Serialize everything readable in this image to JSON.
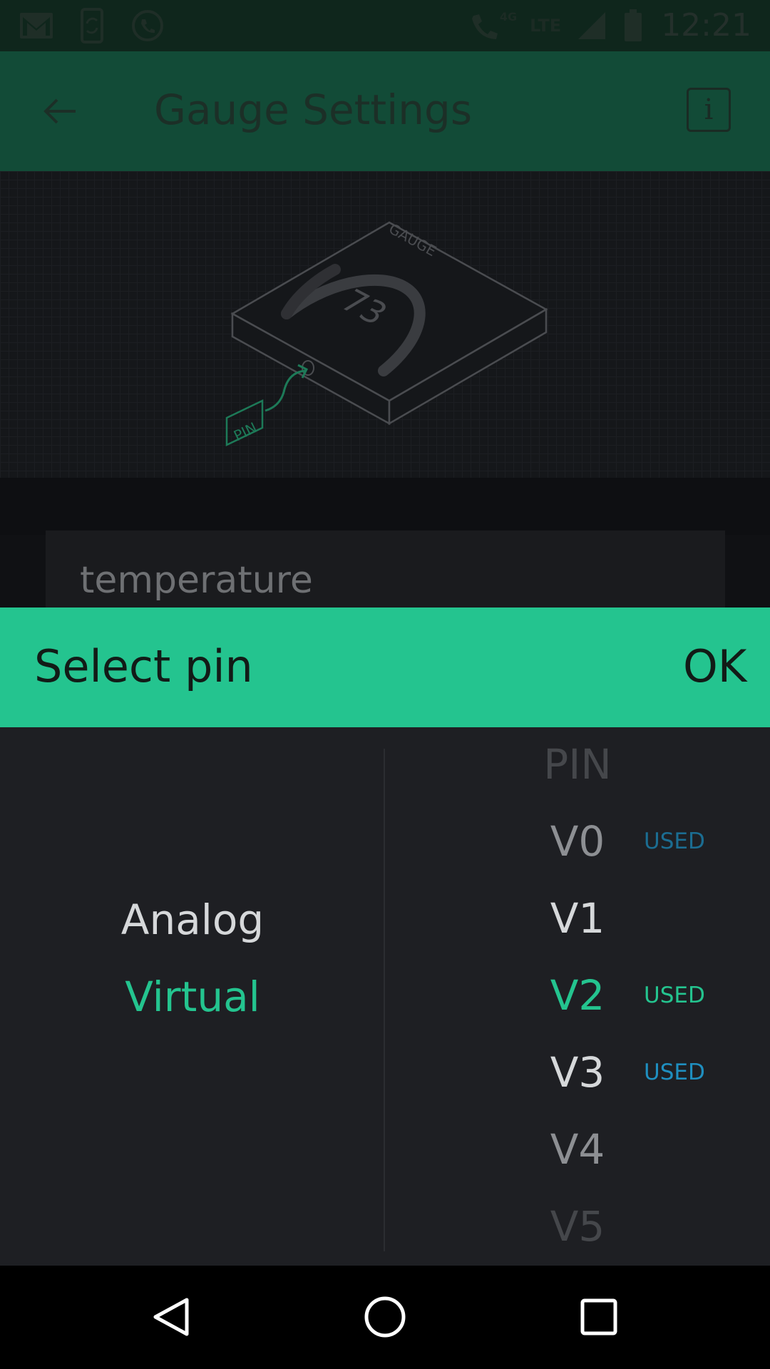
{
  "status_bar": {
    "time": "12:21",
    "network_4g": "4G",
    "network_lte": "LTE",
    "left_icons": [
      "gmail-icon",
      "sync-phone-icon",
      "missed-call-icon"
    ],
    "right_icons": [
      "wifi-call-icon",
      "signal-icon",
      "battery-icon"
    ]
  },
  "app_bar": {
    "title": "Gauge Settings",
    "back_icon": "back-arrow-icon",
    "info_label": "i"
  },
  "illustration": {
    "widget_label": "GAUGE",
    "gauge_value": "73",
    "pin_label": "PIN"
  },
  "name_field": {
    "value": "temperature"
  },
  "dialog": {
    "title": "Select pin",
    "ok_label": "OK",
    "modes": [
      {
        "label": "Analog",
        "selected": false
      },
      {
        "label": "Virtual",
        "selected": true
      }
    ],
    "pins_header": "PIN",
    "pins": [
      {
        "label": "V0",
        "used": "USED",
        "selected": false
      },
      {
        "label": "V1",
        "used": "",
        "selected": false
      },
      {
        "label": "V2",
        "used": "USED",
        "selected": true
      },
      {
        "label": "V3",
        "used": "USED",
        "selected": false
      },
      {
        "label": "V4",
        "used": "",
        "selected": false
      },
      {
        "label": "V5",
        "used": "",
        "selected": false
      }
    ]
  },
  "nav_bar": {
    "icons": [
      "nav-back-icon",
      "nav-home-icon",
      "nav-recents-icon"
    ]
  },
  "colors": {
    "accent": "#24c48f",
    "used_badge": "#1f8fc0",
    "app_bar": "#124b37",
    "status_bar": "#0f261c"
  }
}
